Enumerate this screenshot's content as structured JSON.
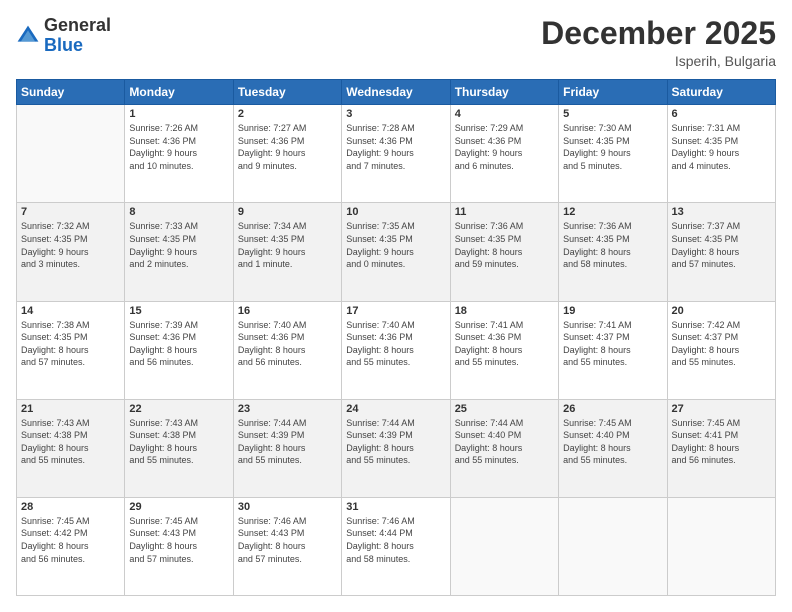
{
  "logo": {
    "general": "General",
    "blue": "Blue"
  },
  "title": "December 2025",
  "location": "Isperih, Bulgaria",
  "days_header": [
    "Sunday",
    "Monday",
    "Tuesday",
    "Wednesday",
    "Thursday",
    "Friday",
    "Saturday"
  ],
  "weeks": [
    [
      {
        "num": "",
        "info": ""
      },
      {
        "num": "1",
        "info": "Sunrise: 7:26 AM\nSunset: 4:36 PM\nDaylight: 9 hours\nand 10 minutes."
      },
      {
        "num": "2",
        "info": "Sunrise: 7:27 AM\nSunset: 4:36 PM\nDaylight: 9 hours\nand 9 minutes."
      },
      {
        "num": "3",
        "info": "Sunrise: 7:28 AM\nSunset: 4:36 PM\nDaylight: 9 hours\nand 7 minutes."
      },
      {
        "num": "4",
        "info": "Sunrise: 7:29 AM\nSunset: 4:36 PM\nDaylight: 9 hours\nand 6 minutes."
      },
      {
        "num": "5",
        "info": "Sunrise: 7:30 AM\nSunset: 4:35 PM\nDaylight: 9 hours\nand 5 minutes."
      },
      {
        "num": "6",
        "info": "Sunrise: 7:31 AM\nSunset: 4:35 PM\nDaylight: 9 hours\nand 4 minutes."
      }
    ],
    [
      {
        "num": "7",
        "info": "Sunrise: 7:32 AM\nSunset: 4:35 PM\nDaylight: 9 hours\nand 3 minutes."
      },
      {
        "num": "8",
        "info": "Sunrise: 7:33 AM\nSunset: 4:35 PM\nDaylight: 9 hours\nand 2 minutes."
      },
      {
        "num": "9",
        "info": "Sunrise: 7:34 AM\nSunset: 4:35 PM\nDaylight: 9 hours\nand 1 minute."
      },
      {
        "num": "10",
        "info": "Sunrise: 7:35 AM\nSunset: 4:35 PM\nDaylight: 9 hours\nand 0 minutes."
      },
      {
        "num": "11",
        "info": "Sunrise: 7:36 AM\nSunset: 4:35 PM\nDaylight: 8 hours\nand 59 minutes."
      },
      {
        "num": "12",
        "info": "Sunrise: 7:36 AM\nSunset: 4:35 PM\nDaylight: 8 hours\nand 58 minutes."
      },
      {
        "num": "13",
        "info": "Sunrise: 7:37 AM\nSunset: 4:35 PM\nDaylight: 8 hours\nand 57 minutes."
      }
    ],
    [
      {
        "num": "14",
        "info": "Sunrise: 7:38 AM\nSunset: 4:35 PM\nDaylight: 8 hours\nand 57 minutes."
      },
      {
        "num": "15",
        "info": "Sunrise: 7:39 AM\nSunset: 4:36 PM\nDaylight: 8 hours\nand 56 minutes."
      },
      {
        "num": "16",
        "info": "Sunrise: 7:40 AM\nSunset: 4:36 PM\nDaylight: 8 hours\nand 56 minutes."
      },
      {
        "num": "17",
        "info": "Sunrise: 7:40 AM\nSunset: 4:36 PM\nDaylight: 8 hours\nand 55 minutes."
      },
      {
        "num": "18",
        "info": "Sunrise: 7:41 AM\nSunset: 4:36 PM\nDaylight: 8 hours\nand 55 minutes."
      },
      {
        "num": "19",
        "info": "Sunrise: 7:41 AM\nSunset: 4:37 PM\nDaylight: 8 hours\nand 55 minutes."
      },
      {
        "num": "20",
        "info": "Sunrise: 7:42 AM\nSunset: 4:37 PM\nDaylight: 8 hours\nand 55 minutes."
      }
    ],
    [
      {
        "num": "21",
        "info": "Sunrise: 7:43 AM\nSunset: 4:38 PM\nDaylight: 8 hours\nand 55 minutes."
      },
      {
        "num": "22",
        "info": "Sunrise: 7:43 AM\nSunset: 4:38 PM\nDaylight: 8 hours\nand 55 minutes."
      },
      {
        "num": "23",
        "info": "Sunrise: 7:44 AM\nSunset: 4:39 PM\nDaylight: 8 hours\nand 55 minutes."
      },
      {
        "num": "24",
        "info": "Sunrise: 7:44 AM\nSunset: 4:39 PM\nDaylight: 8 hours\nand 55 minutes."
      },
      {
        "num": "25",
        "info": "Sunrise: 7:44 AM\nSunset: 4:40 PM\nDaylight: 8 hours\nand 55 minutes."
      },
      {
        "num": "26",
        "info": "Sunrise: 7:45 AM\nSunset: 4:40 PM\nDaylight: 8 hours\nand 55 minutes."
      },
      {
        "num": "27",
        "info": "Sunrise: 7:45 AM\nSunset: 4:41 PM\nDaylight: 8 hours\nand 56 minutes."
      }
    ],
    [
      {
        "num": "28",
        "info": "Sunrise: 7:45 AM\nSunset: 4:42 PM\nDaylight: 8 hours\nand 56 minutes."
      },
      {
        "num": "29",
        "info": "Sunrise: 7:45 AM\nSunset: 4:43 PM\nDaylight: 8 hours\nand 57 minutes."
      },
      {
        "num": "30",
        "info": "Sunrise: 7:46 AM\nSunset: 4:43 PM\nDaylight: 8 hours\nand 57 minutes."
      },
      {
        "num": "31",
        "info": "Sunrise: 7:46 AM\nSunset: 4:44 PM\nDaylight: 8 hours\nand 58 minutes."
      },
      {
        "num": "",
        "info": ""
      },
      {
        "num": "",
        "info": ""
      },
      {
        "num": "",
        "info": ""
      }
    ]
  ]
}
